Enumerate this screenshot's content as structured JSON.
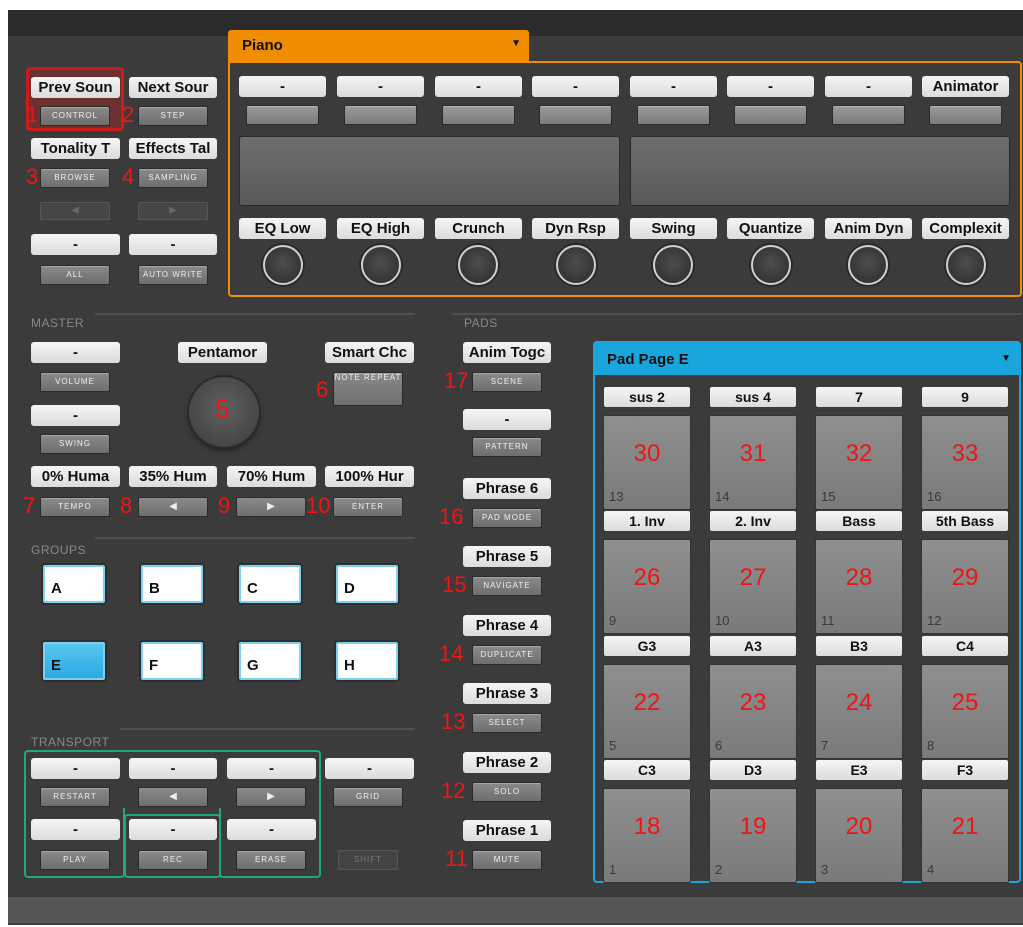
{
  "header": {
    "instrument": "Piano",
    "pad_page": "Pad Page E"
  },
  "controls": {
    "prev_sound": "Prev Soun",
    "next_sound": "Next Sour",
    "control": "CONTROL",
    "step": "STEP",
    "tonality": "Tonality T",
    "effects": "Effects Tal",
    "browse": "BROWSE",
    "sampling": "SAMPLING",
    "left_label": "-",
    "right_label": "-",
    "all": "ALL",
    "auto_write": "AUTO WRITE",
    "arrow_left": "◀",
    "arrow_right": "▶"
  },
  "piano": {
    "top_labels": [
      "-",
      "-",
      "-",
      "-",
      "-",
      "-",
      "-",
      "Animator"
    ],
    "knob_labels": [
      "EQ Low",
      "EQ High",
      "Crunch",
      "Dyn Rsp",
      "Swing",
      "Quantize",
      "Anim Dyn",
      "Complexit"
    ]
  },
  "master": {
    "section": "MASTER",
    "volume_label": "-",
    "volume": "VOLUME",
    "swing_label": "-",
    "swing": "SWING",
    "scale": "Pentamor",
    "smart": "Smart Chc",
    "note_repeat": "NOTE REPEAT",
    "humanize": [
      "0% Huma",
      "35% Hum",
      "70% Hum",
      "100% Hur"
    ],
    "tempo": "TEMPO",
    "enter": "ENTER"
  },
  "groups": {
    "section": "GROUPS",
    "items": [
      "A",
      "B",
      "C",
      "D",
      "E",
      "F",
      "G",
      "H"
    ],
    "selected": "E"
  },
  "transport": {
    "section": "TRANSPORT",
    "labels": [
      "-",
      "-",
      "-",
      "-",
      "-",
      "-",
      "-"
    ],
    "restart": "RESTART",
    "grid": "GRID",
    "play": "PLAY",
    "rec": "REC",
    "erase": "ERASE",
    "shift": "SHIFT"
  },
  "pads_col": {
    "section": "PADS",
    "anim_toggle": "Anim Togc",
    "scene": "SCENE",
    "pattern_label": "-",
    "pattern": "PATTERN",
    "phrase6": "Phrase 6",
    "pad_mode": "PAD MODE",
    "phrase5": "Phrase 5",
    "navigate": "NAVIGATE",
    "phrase4": "Phrase 4",
    "duplicate": "DUPLICATE",
    "phrase3": "Phrase 3",
    "select": "SELECT",
    "phrase2": "Phrase 2",
    "solo": "SOLO",
    "phrase1": "Phrase 1",
    "mute": "MUTE"
  },
  "pad_grid": {
    "rows": [
      {
        "labels": [
          "sus 2",
          "sus 4",
          "7",
          "9"
        ],
        "numbers": [
          "30",
          "31",
          "32",
          "33"
        ],
        "indices": [
          "13",
          "14",
          "15",
          "16"
        ]
      },
      {
        "labels": [
          "1. Inv",
          "2. Inv",
          "Bass",
          "5th Bass"
        ],
        "numbers": [
          "26",
          "27",
          "28",
          "29"
        ],
        "indices": [
          "9",
          "10",
          "11",
          "12"
        ]
      },
      {
        "labels": [
          "G3",
          "A3",
          "B3",
          "C4"
        ],
        "numbers": [
          "22",
          "23",
          "24",
          "25"
        ],
        "indices": [
          "5",
          "6",
          "7",
          "8"
        ]
      },
      {
        "labels": [
          "C3",
          "D3",
          "E3",
          "F3"
        ],
        "numbers": [
          "18",
          "19",
          "20",
          "21"
        ],
        "indices": [
          "1",
          "2",
          "3",
          "4"
        ]
      }
    ]
  },
  "annotations": [
    "1",
    "2",
    "3",
    "4",
    "5",
    "6",
    "7",
    "8",
    "9",
    "10",
    "11",
    "12",
    "13",
    "14",
    "15",
    "16",
    "17"
  ],
  "colors": {
    "orange": "#f08c00",
    "blue": "#1aa5dc",
    "red": "#cc1b1b",
    "green": "#20a878",
    "annotation": "#f01414"
  }
}
